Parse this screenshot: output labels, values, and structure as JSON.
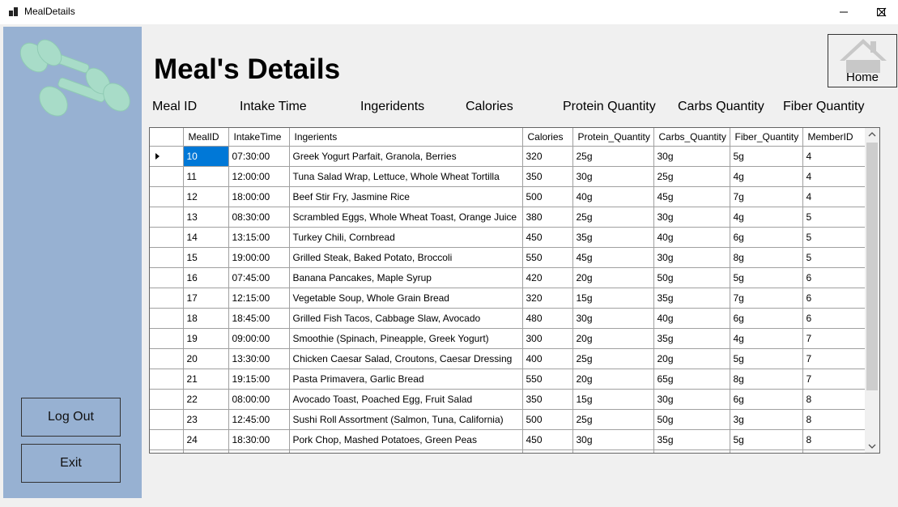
{
  "window": {
    "title": "MealDetails"
  },
  "sidebar": {
    "logout_label": "Log Out",
    "exit_label": "Exit"
  },
  "page": {
    "title": "Meal's Details",
    "home_label": "Home"
  },
  "fields": [
    {
      "label": "Meal ID"
    },
    {
      "label": "Intake Time"
    },
    {
      "label": "Ingeridents"
    },
    {
      "label": "Calories"
    },
    {
      "label": "Protein Quantity"
    },
    {
      "label": "Carbs Quantity"
    },
    {
      "label": "Fiber Quantity"
    }
  ],
  "grid": {
    "columns": [
      "MealID",
      "IntakeTime",
      "Ingerients",
      "Calories",
      "Protein_Quantity",
      "Carbs_Quantity",
      "Fiber_Quantity",
      "MemberID"
    ],
    "rows": [
      [
        "10",
        "07:30:00",
        "Greek Yogurt Parfait, Granola, Berries",
        "320",
        "25g",
        "30g",
        "5g",
        "4"
      ],
      [
        "11",
        "12:00:00",
        "Tuna Salad Wrap, Lettuce, Whole Wheat Tortilla",
        "350",
        "30g",
        "25g",
        "4g",
        "4"
      ],
      [
        "12",
        "18:00:00",
        "Beef Stir Fry, Jasmine Rice",
        "500",
        "40g",
        "45g",
        "7g",
        "4"
      ],
      [
        "13",
        "08:30:00",
        "Scrambled Eggs, Whole Wheat Toast, Orange Juice",
        "380",
        "25g",
        "30g",
        "4g",
        "5"
      ],
      [
        "14",
        "13:15:00",
        "Turkey Chili, Cornbread",
        "450",
        "35g",
        "40g",
        "6g",
        "5"
      ],
      [
        "15",
        "19:00:00",
        "Grilled Steak, Baked Potato, Broccoli",
        "550",
        "45g",
        "30g",
        "8g",
        "5"
      ],
      [
        "16",
        "07:45:00",
        "Banana Pancakes, Maple Syrup",
        "420",
        "20g",
        "50g",
        "5g",
        "6"
      ],
      [
        "17",
        "12:15:00",
        "Vegetable Soup, Whole Grain Bread",
        "320",
        "15g",
        "35g",
        "7g",
        "6"
      ],
      [
        "18",
        "18:45:00",
        "Grilled Fish Tacos, Cabbage Slaw, Avocado",
        "480",
        "30g",
        "40g",
        "6g",
        "6"
      ],
      [
        "19",
        "09:00:00",
        "Smoothie (Spinach, Pineapple, Greek Yogurt)",
        "300",
        "20g",
        "35g",
        "4g",
        "7"
      ],
      [
        "20",
        "13:30:00",
        "Chicken Caesar Salad, Croutons, Caesar Dressing",
        "400",
        "25g",
        "20g",
        "5g",
        "7"
      ],
      [
        "21",
        "19:15:00",
        "Pasta Primavera, Garlic Bread",
        "550",
        "20g",
        "65g",
        "8g",
        "7"
      ],
      [
        "22",
        "08:00:00",
        "Avocado Toast, Poached Egg, Fruit Salad",
        "350",
        "15g",
        "30g",
        "6g",
        "8"
      ],
      [
        "23",
        "12:45:00",
        "Sushi Roll Assortment (Salmon, Tuna, California)",
        "500",
        "25g",
        "50g",
        "3g",
        "8"
      ],
      [
        "24",
        "18:30:00",
        "Pork Chop, Mashed Potatoes, Green Peas",
        "450",
        "30g",
        "35g",
        "5g",
        "8"
      ],
      [
        "",
        "",
        "",
        "",
        "",
        "",
        "",
        ""
      ]
    ],
    "selected_row": 0
  },
  "icons": {
    "logo": "dumbbell-icon",
    "home": "house-icon",
    "current_row": "row-pointer-icon"
  },
  "colors": {
    "sidebar": "#97b1d2",
    "dumbbell": "#a8dcc8",
    "selection": "#0078d7",
    "house": "#c8c8c8"
  }
}
